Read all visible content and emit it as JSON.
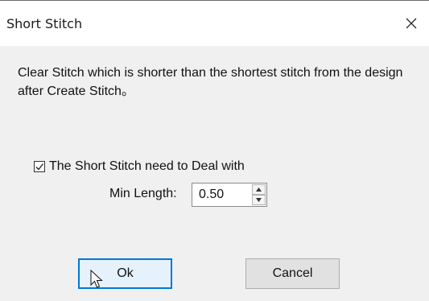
{
  "window": {
    "title": "Short Stitch",
    "close_glyph": "✕"
  },
  "message": "Clear Stitch which is shorter than the shortest stitch from the design after Create Stitch。",
  "option": {
    "checkbox_label": "The Short Stitch need to Deal with",
    "checked": true,
    "min_length_label": "Min Length:",
    "min_length_value": "0.50"
  },
  "buttons": {
    "ok": "Ok",
    "cancel": "Cancel"
  },
  "icons": {
    "close": "close-icon",
    "check": "checkmark-icon",
    "spin_up": "triangle-up-icon",
    "spin_down": "triangle-down-icon",
    "cursor": "mouse-pointer-icon"
  },
  "colors": {
    "client_bg": "#f0f0f0",
    "focus_border": "#0078d7"
  }
}
